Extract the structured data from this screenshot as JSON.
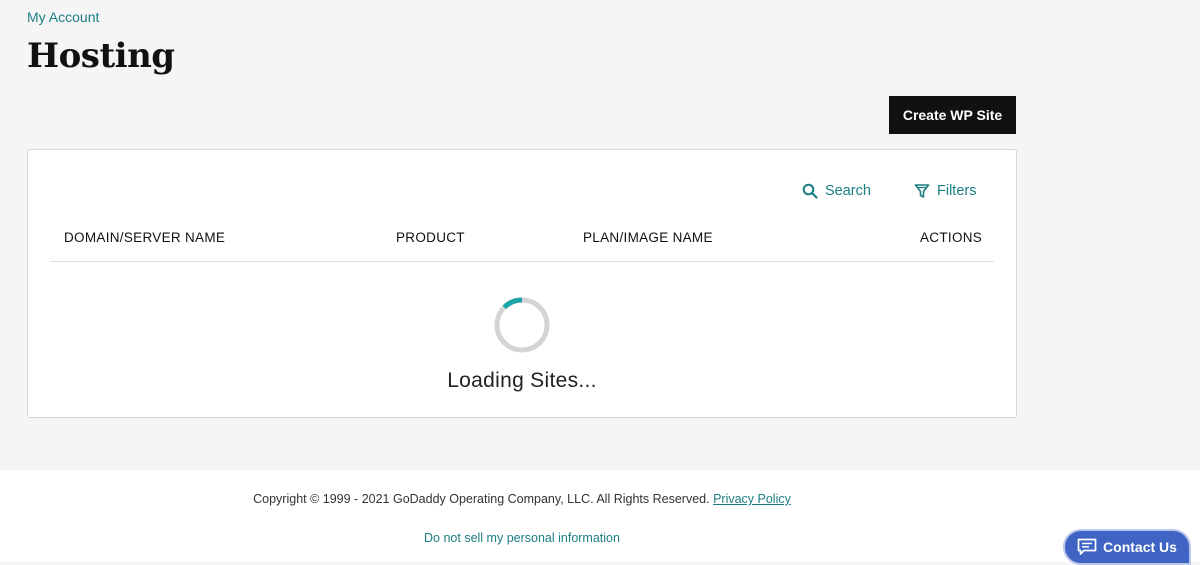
{
  "breadcrumb": {
    "label": "My Account"
  },
  "page": {
    "title": "Hosting"
  },
  "toolbar": {
    "create_label": "Create WP Site"
  },
  "table": {
    "search_label": "Search",
    "filters_label": "Filters",
    "columns": [
      "DOMAIN/SERVER NAME",
      "PRODUCT",
      "PLAN/IMAGE NAME",
      "ACTIONS"
    ],
    "loading_text": "Loading Sites..."
  },
  "footer": {
    "copyright": "Copyright © 1999 - 2021 GoDaddy Operating Company, LLC. All Rights Reserved.",
    "privacy_label": "Privacy Policy",
    "do_not_sell": "Do not sell my personal information"
  },
  "contact": {
    "label": "Contact Us"
  },
  "icons": {
    "search": "search-icon",
    "filters": "filter-icon",
    "spinner": "loading-spinner-icon",
    "chat": "chat-bubble-icon"
  },
  "colors": {
    "accent": "#1b7e83",
    "background": "#f5f5f6",
    "primary_button": "#111111",
    "contact_button": "#3f64c4",
    "spinner_track": "#d4d4d4",
    "spinner_arc": "#1ba3a8"
  }
}
